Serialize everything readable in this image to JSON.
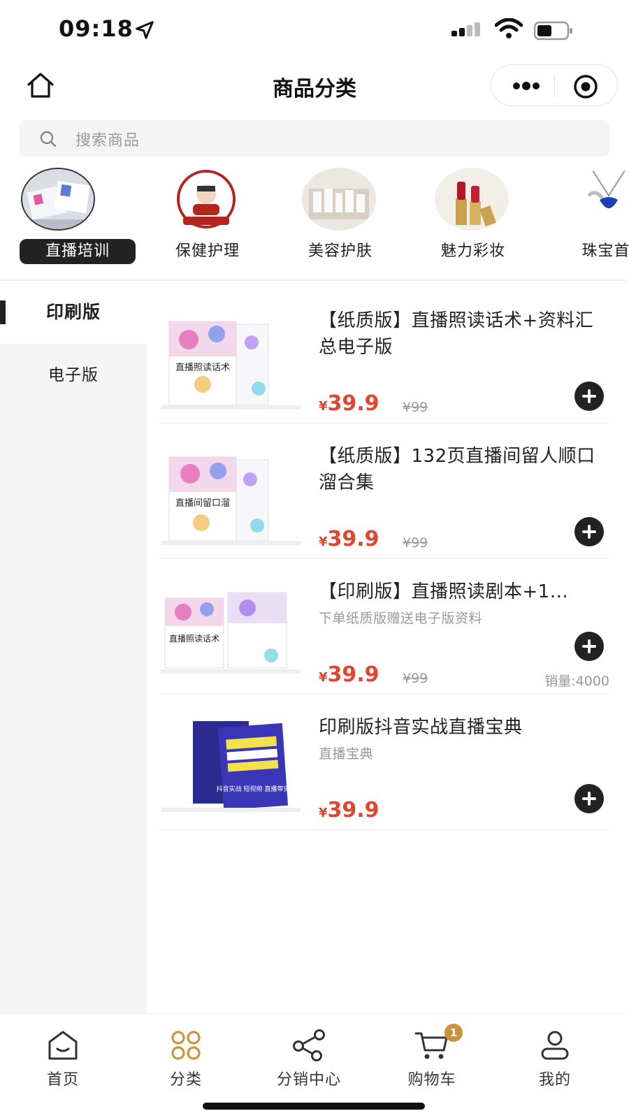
{
  "status_bar": {
    "time": "09:18"
  },
  "nav": {
    "title": "商品分类"
  },
  "search": {
    "placeholder": "搜索商品"
  },
  "categories": [
    {
      "label": "直播培训",
      "active": true
    },
    {
      "label": "保健护理",
      "active": false
    },
    {
      "label": "美容护肤",
      "active": false
    },
    {
      "label": "魅力彩妆",
      "active": false
    },
    {
      "label": "珠宝首",
      "active": false
    }
  ],
  "sidebar": {
    "items": [
      {
        "label": "印刷版",
        "active": true
      },
      {
        "label": "电子版",
        "active": false
      }
    ]
  },
  "products": [
    {
      "title": "【纸质版】直播照读话术+资料汇总电子版",
      "subtitle": "",
      "currency": "¥",
      "price": "39.9",
      "original_price": "¥99",
      "sales": ""
    },
    {
      "title": "【纸质版】132页直播间留人顺口溜合集",
      "subtitle": "",
      "currency": "¥",
      "price": "39.9",
      "original_price": "¥99",
      "sales": ""
    },
    {
      "title": "【印刷版】直播照读剧本+1...",
      "subtitle": "下单纸质版赠送电子版资料",
      "currency": "¥",
      "price": "39.9",
      "original_price": "¥99",
      "sales": "销量:4000"
    },
    {
      "title": "印刷版抖音实战直播宝典",
      "subtitle": "直播宝典",
      "currency": "¥",
      "price": "39.9",
      "original_price": "",
      "sales": ""
    }
  ],
  "product_images": [
    {
      "cover_text": "直播照读话术"
    },
    {
      "cover_text": "直播间留口溜"
    },
    {
      "cover_text": "直播照读话术"
    },
    {
      "cover_text": "抖音实战 短视频 直播带货"
    }
  ],
  "tabbar": {
    "items": [
      {
        "label": "首页",
        "icon": "home-icon"
      },
      {
        "label": "分类",
        "icon": "category-icon",
        "active": true
      },
      {
        "label": "分销中心",
        "icon": "share-icon"
      },
      {
        "label": "购物车",
        "icon": "cart-icon",
        "badge": "1"
      },
      {
        "label": "我的",
        "icon": "user-icon"
      }
    ]
  },
  "colors": {
    "price": "#e0462f",
    "accent": "#c9943b",
    "dark": "#222222"
  }
}
